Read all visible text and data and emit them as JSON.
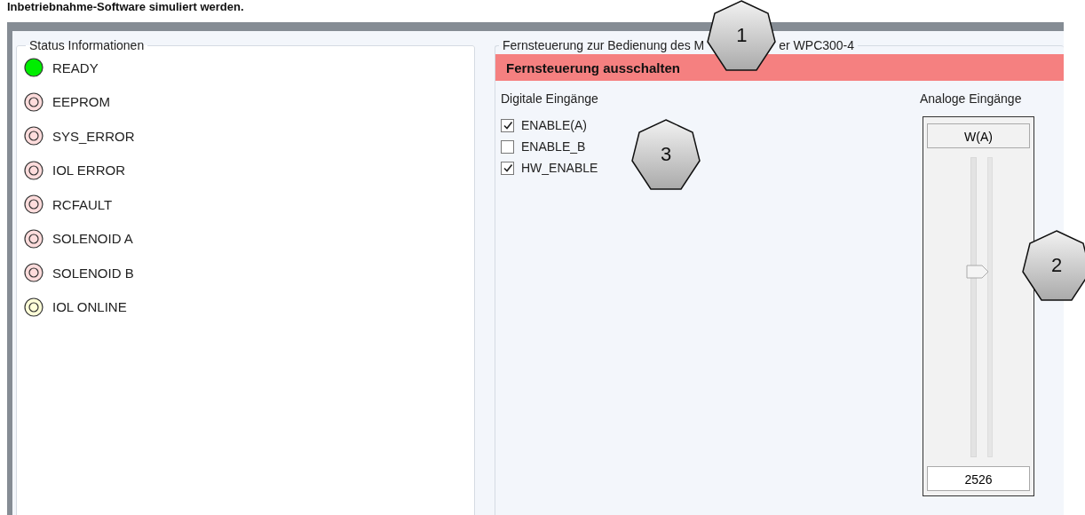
{
  "document_text": "Inbetriebnahme-Software simuliert werden.",
  "status_panel": {
    "title": "Status Informationen",
    "leds": [
      {
        "label": "READY",
        "on": true,
        "color": "#00ee00"
      },
      {
        "label": "EEPROM",
        "on": false,
        "color": "#ffdcdc"
      },
      {
        "label": "SYS_ERROR",
        "on": false,
        "color": "#ffdcdc"
      },
      {
        "label": "IOL ERROR",
        "on": false,
        "color": "#ffdcdc"
      },
      {
        "label": "RCFAULT",
        "on": false,
        "color": "#ffdcdc"
      },
      {
        "label": "SOLENOID A",
        "on": false,
        "color": "#ffdcdc"
      },
      {
        "label": "SOLENOID B",
        "on": false,
        "color": "#ffdcdc"
      },
      {
        "label": "IOL ONLINE",
        "on": false,
        "color": "#ffffd8"
      }
    ]
  },
  "remote_panel": {
    "title_parts": [
      "Fernsteuerung zur Bedienung des M",
      "er WPC300-4"
    ],
    "toggle_button": "Fernsteuerung ausschalten",
    "digital_inputs": {
      "title": "Digitale Eingänge",
      "items": [
        {
          "label": "ENABLE(A)",
          "checked": true
        },
        {
          "label": "ENABLE_B",
          "checked": false
        },
        {
          "label": "HW_ENABLE",
          "checked": true
        }
      ]
    },
    "analog_inputs": {
      "title": "Analoge Eingänge",
      "channel": "W(A)",
      "level": 0.62,
      "value": "2526"
    }
  },
  "callouts": [
    {
      "number": "1"
    },
    {
      "number": "2"
    },
    {
      "number": "3"
    }
  ]
}
